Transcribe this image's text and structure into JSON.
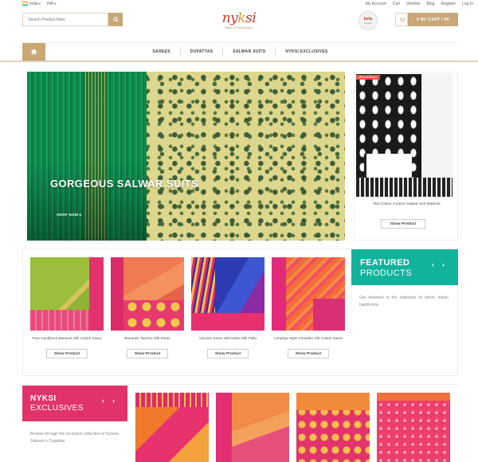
{
  "topbar": {
    "country": "India",
    "currency": "INR",
    "links": [
      "My Account",
      "Cart",
      "Wishlist",
      "Blog",
      "Register",
      "Log In"
    ]
  },
  "search": {
    "placeholder": "Search Product Here"
  },
  "logo": {
    "word_a": "ny",
    "word_b": "k",
    "word_c": "si",
    "tagline": "Bliss of Handlooms"
  },
  "beta": {
    "line1": "beta",
    "line2": "version"
  },
  "cart": {
    "label": "0   MY CART / ₹0"
  },
  "nav": {
    "items": [
      "SAREES",
      "DUPATTAS",
      "SALWAR SUITS",
      "NYKSI EXCLUSIVES"
    ]
  },
  "hero": {
    "title": "GORGEOUS SALWAR SUITS",
    "cta": "SHOP NOW ▸"
  },
  "side_product": {
    "badge": "NEW ARRIVAL",
    "name": "Ikat Cotton 3-piece Salwar Suit Material",
    "button": "Show Product"
  },
  "featured": {
    "title1": "FEATURED",
    "title2": "PRODUCTS",
    "prev": "‹",
    "next": "›",
    "description": "Get drowned in the collection of ethnic Indian handlooms",
    "products": [
      {
        "name": "Pure Handloom Banaras Silk Cotton Saree",
        "button": "Show Product"
      },
      {
        "name": "Banarasi Tanchoi Silk Saree",
        "button": "Show Product"
      },
      {
        "name": "Viscose Saree with Maha Silk Pallu",
        "button": "Show Product"
      },
      {
        "name": "Lehariya Style Chanderi Silk Cotton Saree",
        "button": "Show Product"
      }
    ]
  },
  "exclusives": {
    "title1": "NYKSI",
    "title2": "EXCLUSIVES",
    "prev": "‹",
    "next": "›",
    "description": "Browse through the exclusive collection of Sarees, Salwars n Dupattas"
  },
  "colors": {
    "accent": "#c9a777",
    "featured": "#12b29b",
    "exclusives": "#e1336a"
  }
}
